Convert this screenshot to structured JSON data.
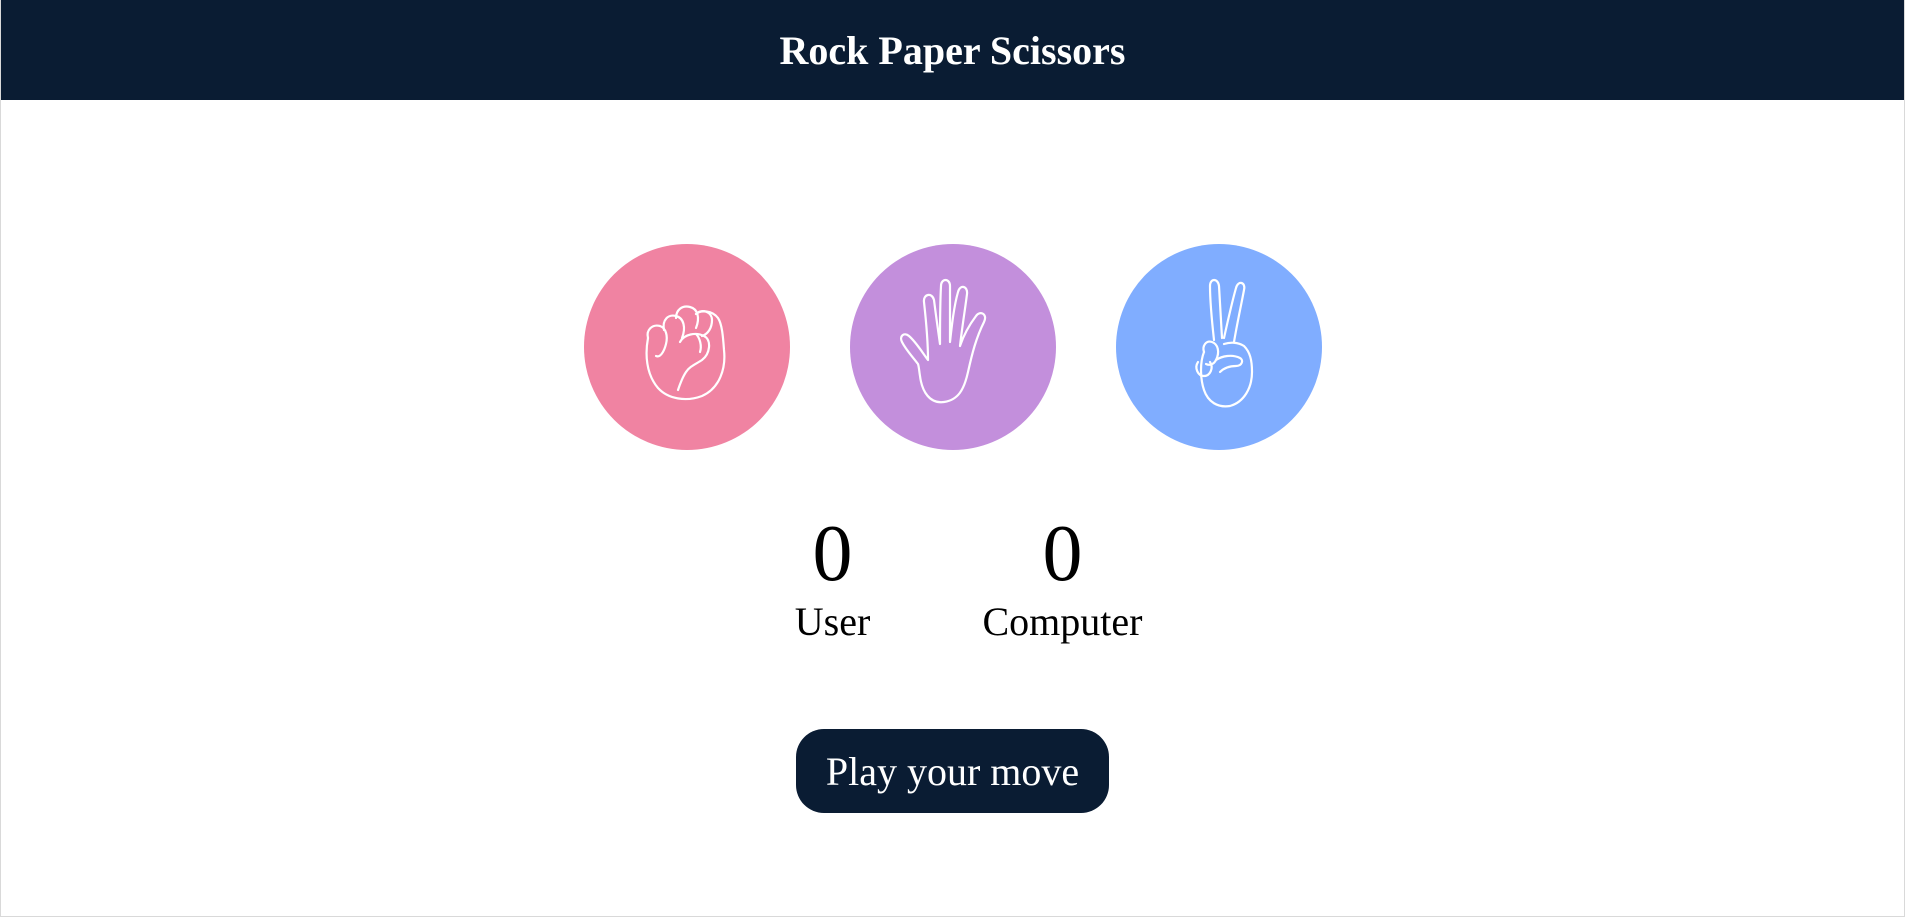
{
  "header": {
    "title": "Rock Paper Scissors"
  },
  "choices": [
    {
      "id": "rock",
      "icon": "fist-icon",
      "color": "#f083a2"
    },
    {
      "id": "paper",
      "icon": "open-hand-icon",
      "color": "#c38fdc"
    },
    {
      "id": "scissors",
      "icon": "peace-hand-icon",
      "color": "#80adff"
    }
  ],
  "scoreboard": {
    "user": {
      "score": "0",
      "label": "User"
    },
    "computer": {
      "score": "0",
      "label": "Computer"
    }
  },
  "message": {
    "text": "Play your move",
    "background": "#0a1c33"
  },
  "colors": {
    "navbar": "#0a1c33",
    "rock": "#f083a2",
    "paper": "#c38fdc",
    "scissors": "#80adff"
  }
}
